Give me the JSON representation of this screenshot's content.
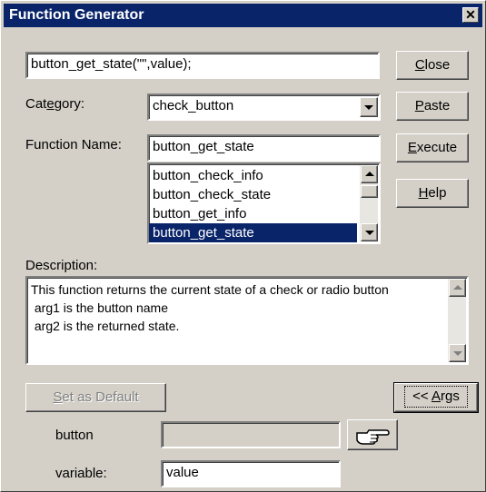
{
  "window": {
    "title": "Function Generator",
    "close_glyph": "✕"
  },
  "expression": {
    "value": "button_get_state(\"\",value);"
  },
  "buttons": {
    "close": {
      "pre": "",
      "mnemonic": "C",
      "post": "lose"
    },
    "paste": {
      "pre": "",
      "mnemonic": "P",
      "post": "aste"
    },
    "execute": {
      "pre": "",
      "mnemonic": "E",
      "post": "xecute"
    },
    "help": {
      "pre": "",
      "mnemonic": "H",
      "post": "elp"
    },
    "set_default": {
      "pre": "",
      "mnemonic": "S",
      "post": "et as Default"
    },
    "args": {
      "pre": "<< ",
      "mnemonic": "A",
      "post": "rgs"
    }
  },
  "category": {
    "label_pre": "Cat",
    "label_mn": "e",
    "label_post": "gory:",
    "value": "check_button"
  },
  "function_name": {
    "label": "Function Name:",
    "value": "button_get_state"
  },
  "function_list": {
    "items": [
      "button_check_info",
      "button_check_state",
      "button_get_info",
      "button_get_state"
    ],
    "selected_index": 3
  },
  "description": {
    "label": "Description:",
    "lines": [
      "This function returns the current state of a check or radio button",
      " arg1 is the button name",
      " arg2 is the returned state."
    ]
  },
  "args": {
    "button_label": "button",
    "button_value": "",
    "variable_label": "variable:",
    "variable_value": "value",
    "pointer_icon": "pointing-hand-icon"
  }
}
